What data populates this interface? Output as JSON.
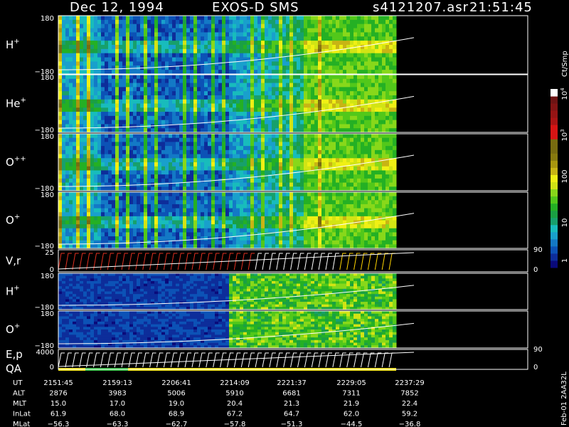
{
  "header": {
    "date": "Dec 12, 1994",
    "instrument": "EXOS-D SMS",
    "file": "s4121207.asr",
    "time": "21:51:45"
  },
  "colorbar": {
    "unit": "Ct/Smp",
    "ticks": [
      "1",
      "10",
      "100",
      "10",
      "10"
    ],
    "tick_exps": [
      "",
      "",
      "",
      "3",
      "4"
    ],
    "colors": [
      "#0a0a7a",
      "#0d2d9a",
      "#0c52b6",
      "#1379c6",
      "#19a0cc",
      "#18bcbc",
      "#17a06c",
      "#1aa043",
      "#24b024",
      "#52c81a",
      "#88d81a",
      "#d2e414",
      "#f0f014",
      "#c8b414",
      "#a8960f",
      "#887a0f",
      "#786b10",
      "#786b10",
      "#d71414",
      "#d71414",
      "#aa1414",
      "#961414",
      "#821414",
      "#6e1414",
      "#ffffff"
    ]
  },
  "panels": [
    {
      "label": "H",
      "sup": "+",
      "ytop": "180",
      "ybot": "−180"
    },
    {
      "label": "He",
      "sup": "+",
      "ytop": "180",
      "ybot": "−180"
    },
    {
      "label": "O",
      "sup": "++",
      "ytop": "180",
      "ybot": "−180"
    },
    {
      "label": "O",
      "sup": "+",
      "ytop": "180",
      "ybot": "−180"
    },
    {
      "label": "V,r",
      "sup": "",
      "ytop": "25",
      "ybot": "0",
      "rtop": "90",
      "rbot": "0"
    },
    {
      "label": "H",
      "sup": "+",
      "ytop": "180",
      "ybot": "−180"
    },
    {
      "label": "O",
      "sup": "+",
      "ytop": "180",
      "ybot": "−180"
    },
    {
      "label": "E,p",
      "label2": "QA",
      "sup": "",
      "ytop": "4000",
      "ybot": "0",
      "rtop": "90",
      "rbot": "0"
    }
  ],
  "side_label": "Feb-01 2AA32L",
  "orbit_table": {
    "rows": [
      {
        "name": "UT",
        "values": [
          "2151:45",
          "2159:13",
          "2206:41",
          "2214:09",
          "2221:37",
          "2229:05",
          "2237:29"
        ]
      },
      {
        "name": "ALT",
        "values": [
          "2876",
          "3983",
          "5006",
          "5910",
          "6681",
          "7311",
          "7852"
        ]
      },
      {
        "name": "MLT",
        "values": [
          "15.0",
          "17.0",
          "19.0",
          "20.4",
          "21.3",
          "21.9",
          "22.4"
        ]
      },
      {
        "name": "InLat",
        "values": [
          "61.9",
          "68.0",
          "68.9",
          "67.2",
          "64.7",
          "62.0",
          "59.2"
        ]
      },
      {
        "name": "MLat",
        "values": [
          "−56.3",
          "−63.3",
          "−62.7",
          "−57.8",
          "−51.3",
          "−44.5",
          "−36.8"
        ]
      }
    ]
  },
  "chart_data": {
    "type": "heatmap",
    "title": "Dec 12, 1994   EXOS-D SMS   s4121207.asr   21:51:45",
    "x_ticks": [
      "2151:45",
      "2159:13",
      "2206:41",
      "2214:09",
      "2221:37",
      "2229:05",
      "2237:29"
    ],
    "colorbar_unit": "Ct/Smp",
    "color_scale": "log",
    "color_range": [
      1,
      10000
    ],
    "series": [
      {
        "name": "H+",
        "yrange": [
          -180,
          180
        ]
      },
      {
        "name": "He+",
        "yrange": [
          -180,
          180
        ]
      },
      {
        "name": "O++",
        "yrange": [
          -180,
          180
        ]
      },
      {
        "name": "O+",
        "yrange": [
          -180,
          180
        ]
      },
      {
        "name": "V,r",
        "yrange": [
          0,
          25
        ],
        "right_range": [
          0,
          90
        ]
      },
      {
        "name": "H+",
        "yrange": [
          -180,
          180
        ]
      },
      {
        "name": "O+",
        "yrange": [
          -180,
          180
        ]
      },
      {
        "name": "E,p",
        "yrange": [
          0,
          4000
        ],
        "right_range": [
          0,
          90
        ]
      }
    ]
  }
}
